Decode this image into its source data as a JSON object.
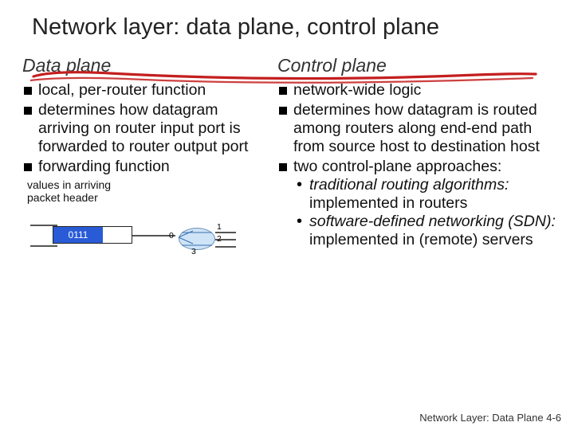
{
  "title": "Network layer: data plane, control plane",
  "left": {
    "heading": "Data plane",
    "b1": "local, per-router function",
    "b2": "determines how datagram arriving on router input port is forwarded to router output port",
    "b3": "forwarding function",
    "caption": "values in arriving\npacket header",
    "packet_bits": "0111",
    "ports": {
      "p0": "0",
      "p1": "1",
      "p2": "2",
      "p3": "3"
    }
  },
  "right": {
    "heading": "Control plane",
    "b1": "network-wide logic",
    "b2": "determines how datagram is routed among routers along end-end path from source host to destination host",
    "b3": "two control-plane approaches:",
    "s1a": "traditional routing algorithms:",
    "s1b": " implemented in routers",
    "s2a": "software-defined networking (SDN):",
    "s2b": " implemented in (remote) servers"
  },
  "footer": {
    "chapter": "Network Layer: Data Plane",
    "page": "4-6"
  }
}
